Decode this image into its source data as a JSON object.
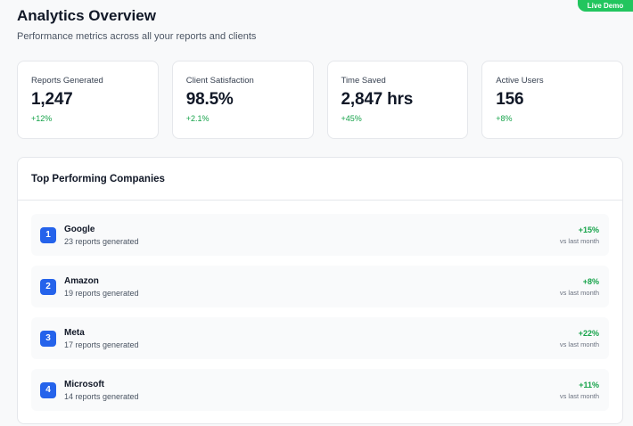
{
  "badge": "Live Demo",
  "header": {
    "title": "Analytics Overview",
    "subtitle": "Performance metrics across all your reports and clients"
  },
  "stats": [
    {
      "label": "Reports Generated",
      "value": "1,247",
      "change": "+12%"
    },
    {
      "label": "Client Satisfaction",
      "value": "98.5%",
      "change": "+2.1%"
    },
    {
      "label": "Time Saved",
      "value": "2,847 hrs",
      "change": "+45%"
    },
    {
      "label": "Active Users",
      "value": "156",
      "change": "+8%"
    }
  ],
  "top_companies": {
    "title": "Top Performing Companies",
    "items": [
      {
        "rank": "1",
        "name": "Google",
        "reports": "23 reports generated",
        "change": "+15%",
        "note": "vs last month"
      },
      {
        "rank": "2",
        "name": "Amazon",
        "reports": "19 reports generated",
        "change": "+8%",
        "note": "vs last month"
      },
      {
        "rank": "3",
        "name": "Meta",
        "reports": "17 reports generated",
        "change": "+22%",
        "note": "vs last month"
      },
      {
        "rank": "4",
        "name": "Microsoft",
        "reports": "14 reports generated",
        "change": "+11%",
        "note": "vs last month"
      }
    ]
  }
}
